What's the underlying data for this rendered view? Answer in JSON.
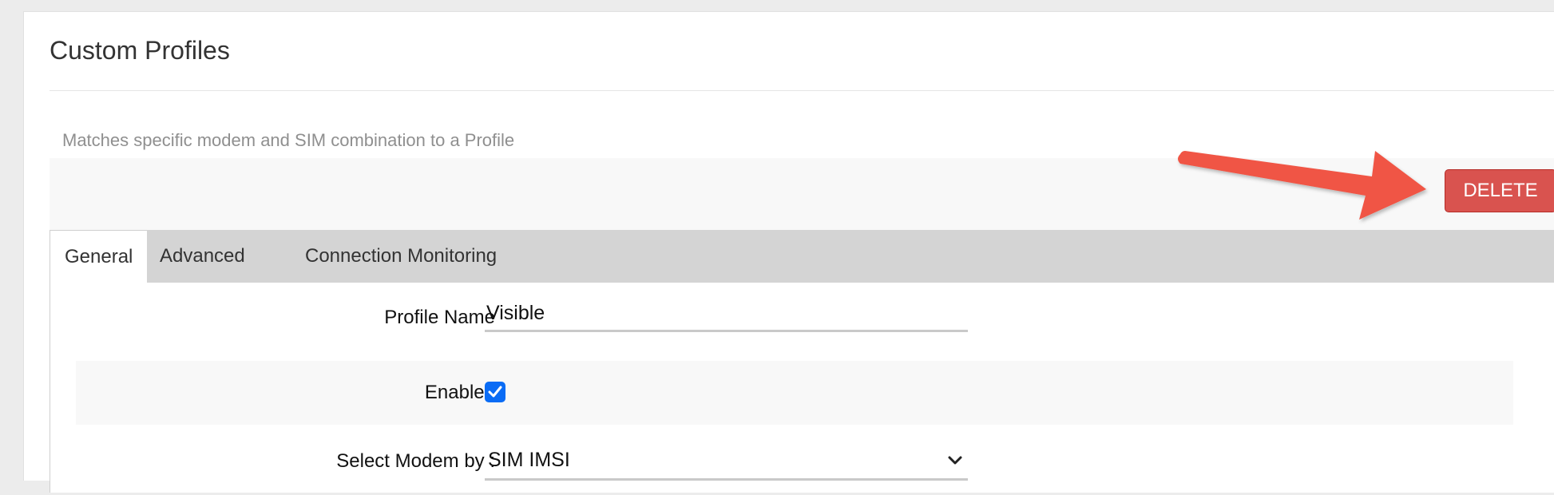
{
  "page": {
    "title": "Custom Profiles",
    "subtitle": "Matches specific modem and SIM combination to a Profile"
  },
  "toolbar": {
    "delete_label": "DELETE"
  },
  "tabs": [
    {
      "label": "General",
      "active": true
    },
    {
      "label": "Advanced",
      "active": false
    },
    {
      "label": "Connection Monitoring",
      "active": false
    }
  ],
  "form": {
    "profile_name": {
      "label": "Profile Name",
      "value": "Visible"
    },
    "enabled": {
      "label": "Enabled",
      "checked": true
    },
    "select_modem_by": {
      "label": "Select Modem by :",
      "value": "SIM IMSI"
    }
  },
  "colors": {
    "delete_button": "#d9534f",
    "annotation_arrow": "#f05545",
    "checkbox": "#0a6cf5",
    "tab_strip": "#d4d4d4"
  },
  "icons": {
    "checkbox_mark": "check-icon",
    "select_chevron": "chevron-down-icon",
    "annotation": "arrow-icon"
  }
}
